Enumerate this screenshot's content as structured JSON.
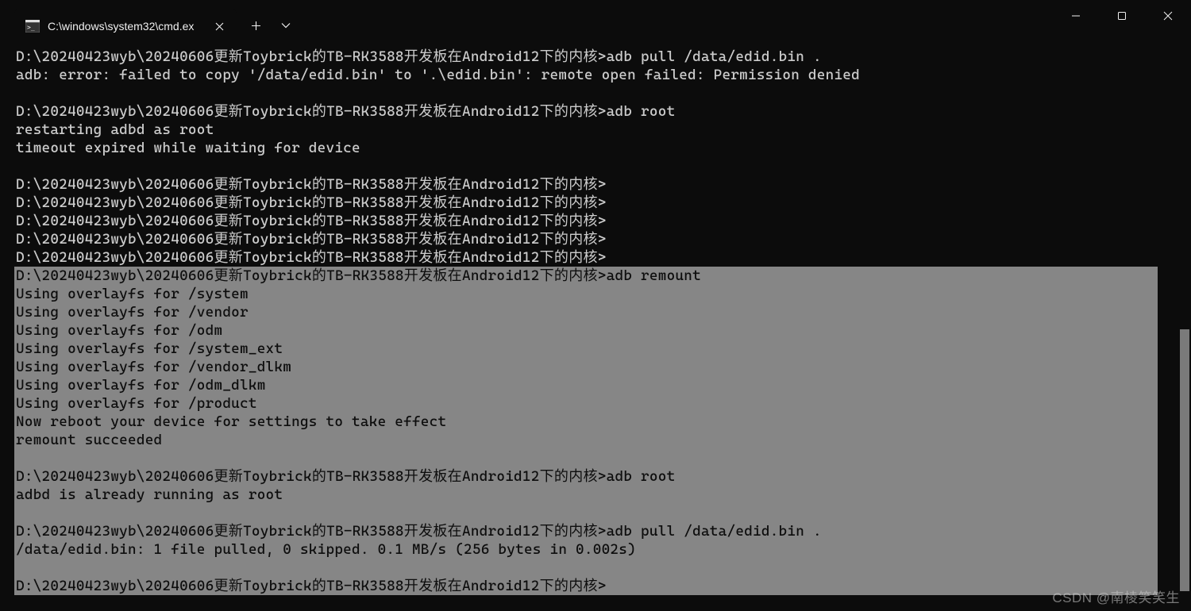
{
  "titlebar": {
    "tab_title": "C:\\windows\\system32\\cmd.ex",
    "new_tab_glyph": "＋",
    "dropdown_glyph": "⌄"
  },
  "terminal": {
    "lines": [
      {
        "text": "D:\\20240423wyb\\20240606更新Toybrick的TB-RK3588开发板在Android12下的内核>adb pull /data/edid.bin .",
        "hl": false
      },
      {
        "text": "adb: error: failed to copy '/data/edid.bin' to '.\\edid.bin': remote open failed: Permission denied",
        "hl": false
      },
      {
        "text": "",
        "hl": false
      },
      {
        "text": "D:\\20240423wyb\\20240606更新Toybrick的TB-RK3588开发板在Android12下的内核>adb root",
        "hl": false
      },
      {
        "text": "restarting adbd as root",
        "hl": false
      },
      {
        "text": "timeout expired while waiting for device",
        "hl": false
      },
      {
        "text": "",
        "hl": false
      },
      {
        "text": "D:\\20240423wyb\\20240606更新Toybrick的TB-RK3588开发板在Android12下的内核>",
        "hl": false
      },
      {
        "text": "D:\\20240423wyb\\20240606更新Toybrick的TB-RK3588开发板在Android12下的内核>",
        "hl": false
      },
      {
        "text": "D:\\20240423wyb\\20240606更新Toybrick的TB-RK3588开发板在Android12下的内核>",
        "hl": false
      },
      {
        "text": "D:\\20240423wyb\\20240606更新Toybrick的TB-RK3588开发板在Android12下的内核>",
        "hl": false
      },
      {
        "text": "D:\\20240423wyb\\20240606更新Toybrick的TB-RK3588开发板在Android12下的内核>",
        "hl": false
      },
      {
        "text": "D:\\20240423wyb\\20240606更新Toybrick的TB-RK3588开发板在Android12下的内核>adb remount",
        "hl": true
      },
      {
        "text": "Using overlayfs for /system",
        "hl": true
      },
      {
        "text": "Using overlayfs for /vendor",
        "hl": true
      },
      {
        "text": "Using overlayfs for /odm",
        "hl": true
      },
      {
        "text": "Using overlayfs for /system_ext",
        "hl": true
      },
      {
        "text": "Using overlayfs for /vendor_dlkm",
        "hl": true
      },
      {
        "text": "Using overlayfs for /odm_dlkm",
        "hl": true
      },
      {
        "text": "Using overlayfs for /product",
        "hl": true
      },
      {
        "text": "Now reboot your device for settings to take effect",
        "hl": true
      },
      {
        "text": "remount succeeded",
        "hl": true
      },
      {
        "text": "",
        "hl": true
      },
      {
        "text": "D:\\20240423wyb\\20240606更新Toybrick的TB-RK3588开发板在Android12下的内核>adb root",
        "hl": true
      },
      {
        "text": "adbd is already running as root",
        "hl": true
      },
      {
        "text": "",
        "hl": true
      },
      {
        "text": "D:\\20240423wyb\\20240606更新Toybrick的TB-RK3588开发板在Android12下的内核>adb pull /data/edid.bin .",
        "hl": true
      },
      {
        "text": "/data/edid.bin: 1 file pulled, 0 skipped. 0.1 MB/s (256 bytes in 0.002s)",
        "hl": true
      },
      {
        "text": "",
        "hl": true
      },
      {
        "text": "D:\\20240423wyb\\20240606更新Toybrick的TB-RK3588开发板在Android12下的内核>",
        "hl": true
      }
    ]
  },
  "watermark": "CSDN @南棱笑笑生"
}
